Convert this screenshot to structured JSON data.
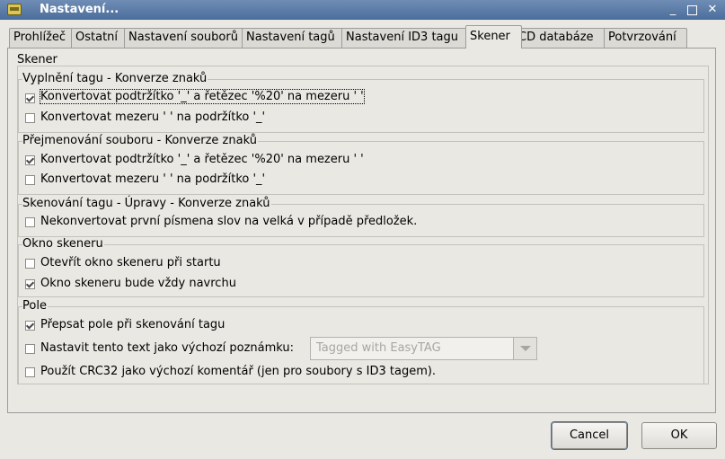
{
  "window": {
    "title": "Nastavení..."
  },
  "tabs": [
    {
      "label": "Prohlížeč"
    },
    {
      "label": "Ostatní"
    },
    {
      "label": "Nastavení souborů"
    },
    {
      "label": "Nastavení tagů"
    },
    {
      "label": "Nastavení ID3 tagu"
    },
    {
      "label": "Skener"
    },
    {
      "label": "CD databáze"
    },
    {
      "label": "Potvrzování"
    }
  ],
  "active_tab": "Skener",
  "main": {
    "section_title": "Skener",
    "groups": [
      {
        "title": "Vyplnění tagu - Konverze znaků",
        "options": [
          {
            "label": "Konvertovat podtržítko '_' a řetězec '%20' na mezeru ' '",
            "checked": true
          },
          {
            "label": "Konvertovat mezeru ' ' na podržítko '_'",
            "checked": false
          }
        ]
      },
      {
        "title": "Přejmenování souboru - Konverze znaků",
        "options": [
          {
            "label": "Konvertovat podtržítko '_' a řetězec '%20' na mezeru ' '",
            "checked": true
          },
          {
            "label": "Konvertovat mezeru ' ' na podržítko '_'",
            "checked": false
          }
        ]
      },
      {
        "title": "Skenování tagu - Úpravy - Konverze znaků",
        "options": [
          {
            "label": "Nekonvertovat první písmena slov na velká v případě předložek.",
            "checked": false
          }
        ]
      },
      {
        "title": "Okno skeneru",
        "options": [
          {
            "label": "Otevřít okno skeneru při startu",
            "checked": false
          },
          {
            "label": "Okno skeneru bude vždy navrchu",
            "checked": true
          }
        ]
      },
      {
        "title": "Pole",
        "options": [
          {
            "label": "Přepsat pole při skenování tagu",
            "checked": true
          },
          {
            "label": "Nastavit tento text jako výchozí poznámku:",
            "checked": false
          },
          {
            "label": "Použít CRC32 jako výchozí komentář (jen pro soubory s ID3 tagem).",
            "checked": false
          }
        ]
      }
    ],
    "default_comment_combo": {
      "value": "Tagged with EasyTAG",
      "enabled": false
    }
  },
  "buttons": {
    "cancel": "Cancel",
    "ok": "OK"
  },
  "colors": {
    "titlebar": "#4c6e9c",
    "background": "#eae8e3"
  }
}
